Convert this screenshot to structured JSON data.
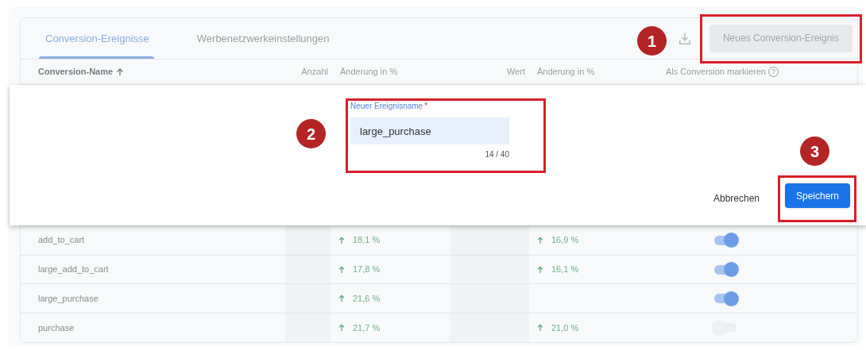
{
  "tabs": [
    {
      "label": "Conversion-Ereignisse",
      "selected": true
    },
    {
      "label": "Werbenetzwerkeinstellungen",
      "selected": false
    }
  ],
  "new_event_button": {
    "label": "Neues Conversion-Ereignis",
    "disabled": true
  },
  "table": {
    "columns": [
      {
        "label": "Conversion-Name",
        "sorted_ascending": true
      },
      {
        "label": "Anzahl"
      },
      {
        "label": "Änderung in %"
      },
      {
        "label": "Wert"
      },
      {
        "label": "Änderung in %"
      },
      {
        "label": "Als Conversion markieren",
        "help": "?"
      }
    ],
    "rows": [
      {
        "name": "add_to_cart",
        "count_change": {
          "rising": true,
          "text": "18,1 %"
        },
        "value_change": {
          "rising": true,
          "text": "16,9 %"
        },
        "on": true
      },
      {
        "name": "large_add_to_cart",
        "count_change": {
          "rising": true,
          "text": "17,8 %"
        },
        "value_change": {
          "rising": true,
          "text": "16,1 %"
        },
        "on": true
      },
      {
        "name": "large_purchase",
        "count_change": {
          "rising": true,
          "text": "21,6 %"
        },
        "on": true
      },
      {
        "name": "purchase",
        "count_change": {
          "rising": true,
          "text": "21,7 %"
        },
        "value_change": {
          "rising": true,
          "text": "21,0 %"
        },
        "on": false
      }
    ]
  },
  "new_event_form": {
    "label": "Neuer Ereignisname",
    "required_mark": "*",
    "value": "large_purchase",
    "counter": "14 / 40",
    "cancel": "Abbrechen",
    "save": "Speichern"
  },
  "annotations": [
    {
      "label": "1"
    },
    {
      "label": "2"
    },
    {
      "label": "3"
    }
  ]
}
